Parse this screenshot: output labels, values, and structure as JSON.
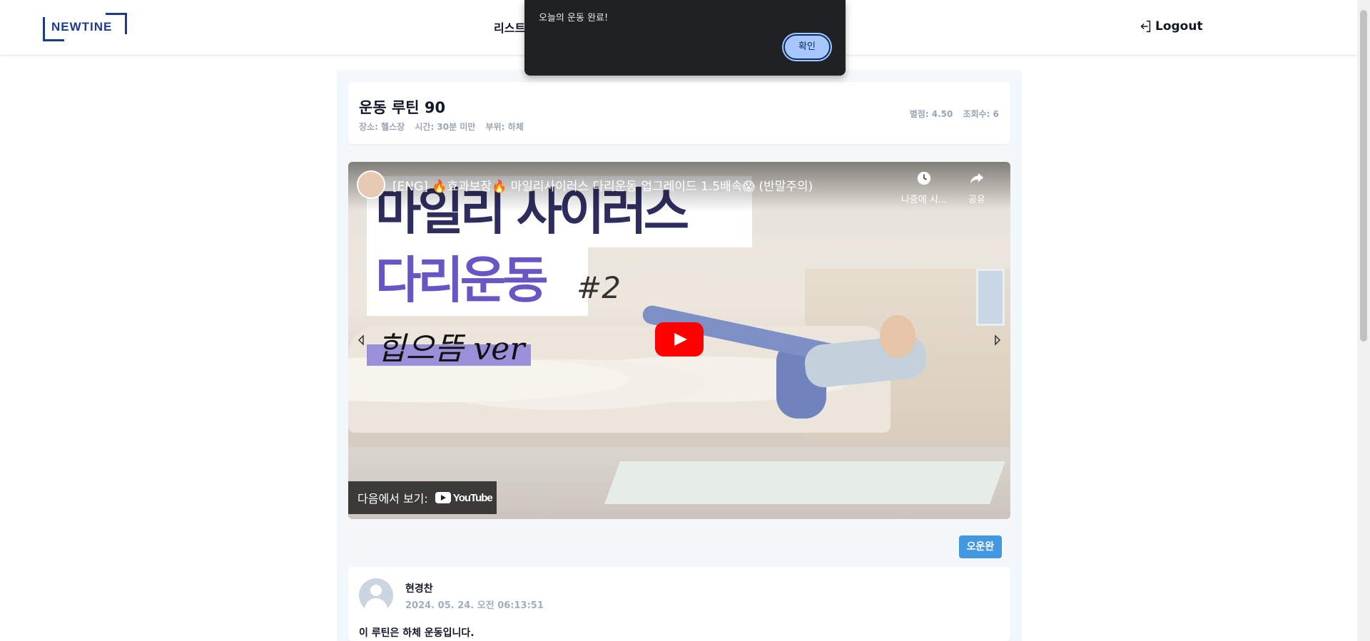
{
  "header": {
    "logo_text": "NEWTINE",
    "nav_label": "리스트",
    "logout_label": "Logout"
  },
  "routine": {
    "title": "운동 루틴 90",
    "place": "장소: 헬스장",
    "time": "시간: 30분 미만",
    "part": "부위: 하체",
    "rating": "별점: 4.50",
    "views": "조회수: 6"
  },
  "video": {
    "title": "[ENG] 🔥효과보장🔥 마일리사이러스 다리운동 업그레이드 1.5배속😱 (반말주의)",
    "watch_later": "나중에 시...",
    "share": "공유",
    "thumb_line1": "마일리 사이러스",
    "thumb_line2": "다리운동",
    "thumb_hash": "#2",
    "thumb_sub": "힙으뜸 ver",
    "watch_on": "다음에서 보기:",
    "youtube": "YouTube"
  },
  "done_button": "오운완",
  "comment": {
    "author": "현경찬",
    "date": "2024. 05. 24. 오전 06:13:51",
    "text": "이 루틴은 하체 운동입니다."
  },
  "alert": {
    "message": "오늘의 운동 완료!",
    "confirm": "확인"
  },
  "colors": {
    "brand": "#1e3a8a",
    "accent": "#4299e1",
    "play": "#ff0000"
  }
}
